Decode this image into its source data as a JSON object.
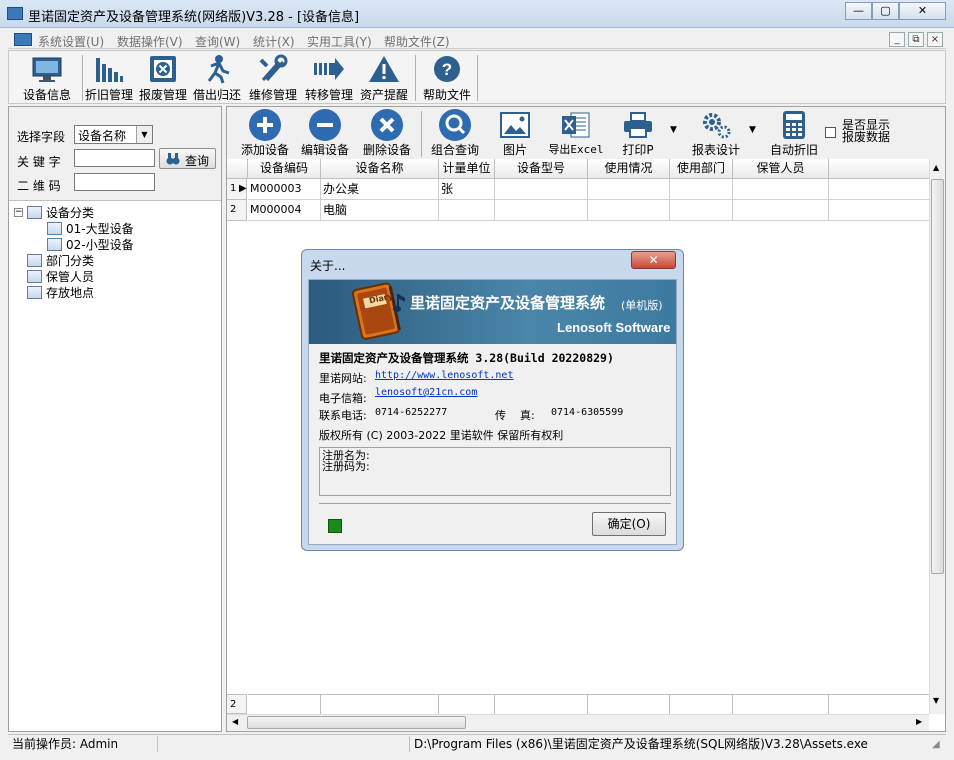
{
  "window": {
    "title": "里诺固定资产及设备管理系统(网络版)V3.28 - [设备信息]",
    "minimize": "—",
    "restore": "▢",
    "close": "✕"
  },
  "menu": [
    "系统设置(U)",
    "数据操作(V)",
    "查询(W)",
    "统计(X)",
    "实用工具(Y)",
    "帮助文件(Z)"
  ],
  "mdi_controls": [
    "_",
    "⧉",
    "×"
  ],
  "toolbar": [
    "设备信息",
    "折旧管理",
    "报废管理",
    "借出归还",
    "维修管理",
    "转移管理",
    "资产提醒",
    "帮助文件"
  ],
  "search": {
    "field_label": "选择字段",
    "field_value": "设备名称",
    "keyword_label": "关 键 字",
    "keyword_value": "",
    "qrcode_label": "二 维 码",
    "qrcode_value": "",
    "query_button": "查询"
  },
  "tree": {
    "root": "设备分类",
    "children": [
      "01-大型设备",
      "02-小型设备"
    ],
    "others": [
      "部门分类",
      "保管人员",
      "存放地点"
    ]
  },
  "toolbar2": [
    "添加设备",
    "编辑设备",
    "删除设备",
    "组合查询",
    "图片",
    "导出Excel",
    "打印P",
    "报表设计",
    "自动折旧"
  ],
  "show_scrapped": {
    "line1": "是否显示",
    "line2": "报废数据"
  },
  "grid": {
    "columns": [
      "设备编码",
      "设备名称",
      "计量单位",
      "设备型号",
      "使用情况",
      "使用部门",
      "保管人员"
    ],
    "rows": [
      {
        "num": "1",
        "cells": [
          "M000003",
          "办公桌",
          "张",
          "",
          "",
          "",
          ""
        ]
      },
      {
        "num": "2",
        "cells": [
          "M000004",
          "电脑",
          "",
          "",
          "",
          "",
          ""
        ]
      }
    ],
    "footer_num": "2"
  },
  "status": {
    "operator": "当前操作员: Admin",
    "path": "D:\\Program Files (x86)\\里诺固定资产及设备理系统(SQL网络版)V3.28\\Assets.exe"
  },
  "dialog": {
    "title": "关于...",
    "close": "✕",
    "banner_title": "里诺固定资产及设备管理系统",
    "banner_edition": "(单机版)",
    "banner_company": "Lenosoft Software",
    "banner_book_label": "Diary",
    "product": "里诺固定资产及设备管理系统 3.28(Build 20220829)",
    "website_label": "里诺网站:",
    "website": "http://www.lenosoft.net",
    "email_label": "电子信箱:",
    "email": "lenosoft@21cn.com",
    "phone_label": "联系电话:",
    "phone": "0714-6252277",
    "fax_label": "传    真:",
    "fax": "0714-6305599",
    "copyright": "版权所有 (C) 2003-2022 里诺软件 保留所有权利",
    "reg_name_label": "注册名为:",
    "reg_code_label": "注册码为:",
    "ok": "确定(O)",
    "status_color": "#1a8a1a"
  }
}
